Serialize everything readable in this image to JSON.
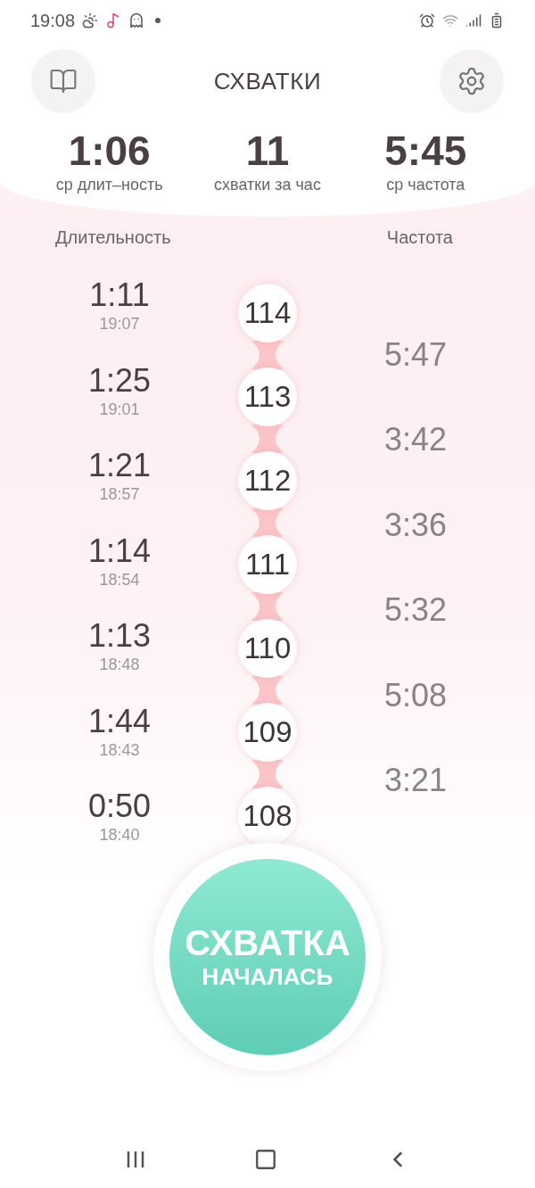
{
  "status_bar": {
    "time": "19:08"
  },
  "header": {
    "title": "СХВАТКИ"
  },
  "stats": [
    {
      "value": "1:06",
      "label": "ср длит–ность"
    },
    {
      "value": "11",
      "label": "схватки за час"
    },
    {
      "value": "5:45",
      "label": "ср частота"
    }
  ],
  "columns": {
    "duration": "Длительность",
    "frequency": "Частота"
  },
  "rows": [
    {
      "number": "114",
      "duration": "1:11",
      "time": "19:07",
      "interval": "5:47"
    },
    {
      "number": "113",
      "duration": "1:25",
      "time": "19:01",
      "interval": "3:42"
    },
    {
      "number": "112",
      "duration": "1:21",
      "time": "18:57",
      "interval": "3:36"
    },
    {
      "number": "111",
      "duration": "1:14",
      "time": "18:54",
      "interval": "5:32"
    },
    {
      "number": "110",
      "duration": "1:13",
      "time": "18:48",
      "interval": "5:08"
    },
    {
      "number": "109",
      "duration": "1:44",
      "time": "18:43",
      "interval": "3:21"
    },
    {
      "number": "108",
      "duration": "0:50",
      "time": "18:40"
    }
  ],
  "start_button": {
    "line_1": "СХВАТКА",
    "line_2": "НАЧАЛАСЬ"
  }
}
